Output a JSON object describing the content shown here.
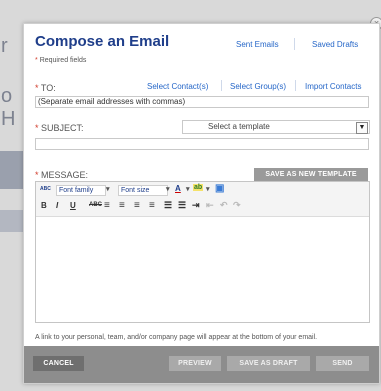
{
  "close_glyph": "×",
  "backdrop": {
    "letters": [
      "r",
      "o",
      "H"
    ]
  },
  "header": {
    "title": "Compose an Email",
    "required_note": "Required fields",
    "required_marker": "*",
    "links": [
      "Sent Emails",
      "Saved Drafts"
    ]
  },
  "to": {
    "label": "TO:",
    "marker": "*",
    "links": [
      "Select Contact(s)",
      "Select Group(s)",
      "Import Contacts"
    ],
    "value": "(Separate email addresses with commas)"
  },
  "subject": {
    "label": "SUBJECT:",
    "marker": "*",
    "template_select": "Select a template",
    "template_arrow": "▼",
    "value": ""
  },
  "message": {
    "label": "MESSAGE:",
    "marker": "*",
    "save_template_button": "SAVE AS NEW TEMPLATE",
    "toolbar": {
      "row1": {
        "spell_icon": "ABC",
        "font_family": "Font family",
        "font_size": "Font size",
        "dd_arrow": "▾",
        "text_color": "A",
        "highlight": "ab",
        "image_icon": "▣"
      },
      "row2": {
        "bold": "B",
        "italic": "I",
        "underline": "U",
        "strike": "ABC",
        "align_left": "≡",
        "align_center": "≡",
        "align_right": "≡",
        "justify": "≡",
        "bullets": "☰",
        "numbers": "☰",
        "indent": "⇥",
        "outdent": "⇤",
        "undo": "↶",
        "redo": "↷"
      }
    }
  },
  "footer_note": "A link to your personal, team, and/or company page will appear at the bottom of your email.",
  "footer": {
    "cancel": "CANCEL",
    "preview": "PREVIEW",
    "save_draft": "SAVE AS DRAFT",
    "send": "SEND"
  },
  "colors": {
    "title": "#1f3e8a",
    "link": "#2667c8",
    "required": "#d13b2a",
    "footer": "#8d8d8d"
  }
}
